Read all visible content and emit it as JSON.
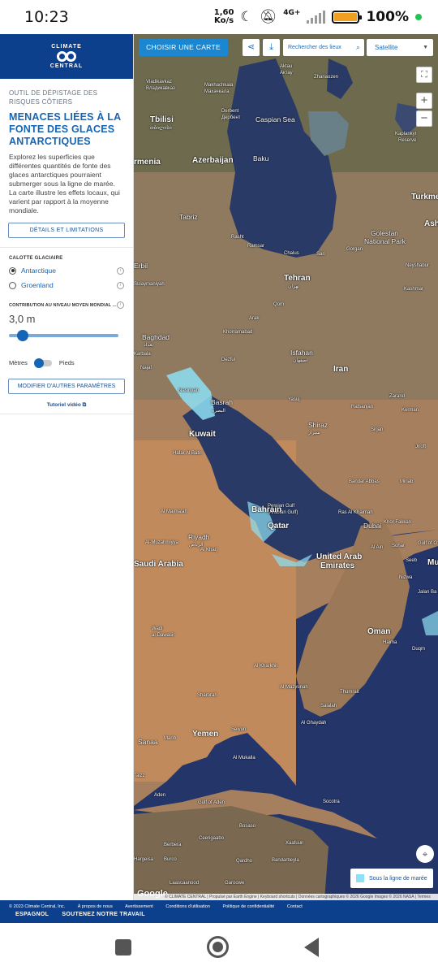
{
  "status_bar": {
    "time": "10:23",
    "net_speed_value": "1,60",
    "net_speed_unit": "Ko/s",
    "network_type": "4G+",
    "battery": "100%"
  },
  "sidebar": {
    "logo_line1": "CLIMATE",
    "logo_line2": "CENTRAL",
    "eyebrow": "OUTIL DE DÉPISTAGE DES RISQUES CÔTIERS",
    "title": "MENACES LIÉES À LA FONTE DES GLACES ANTARCTIQUES",
    "description": "Explorez les superficies que différentes quantités de fonte des glaces antarctiques pourraient submerger sous la ligne de marée. La carte illustre les effets locaux, qui varient par rapport à la moyenne mondiale.",
    "details_button": "DÉTAILS ET LIMITATIONS",
    "ice_cap_label": "CALOTTE GLACIAIRE",
    "ice_caps": [
      {
        "label": "Antarctique",
        "selected": true
      },
      {
        "label": "Groenland",
        "selected": false
      }
    ],
    "contribution_label": "CONTRIBUTION AU NIVEAU MOYEN MONDIAL ...",
    "contribution_value": "3,0 m",
    "unit_left": "Mètres",
    "unit_right": "Pieds",
    "modify_button": "MODIFIER D'AUTRES PARAMÈTRES",
    "tutorial_link": "Tutoriel vidéo"
  },
  "map": {
    "choose_map_button": "CHOISIR UNE CARTE",
    "search_placeholder": "Rechercher des lieux",
    "layer_select": "Satellite",
    "legend_label": "Sous la ligne de marée",
    "google": "Google",
    "attribution": "© CLIMATE CENTRAL | Propulsé par Earth Engine | Keyboard shortcuts | Données cartographiques © 2026 Google Images © 2026 NASA | Termes",
    "labels": {
      "caspian_sea": "Caspian Sea",
      "azerbaijan": "Azerbaijan",
      "armenia": "rmenia",
      "turkmen": "Turkme",
      "tbilisi": "Tbilisi",
      "tbilisi_local": "თბილისი",
      "baku": "Baku",
      "vladikavkaz": "Vladikavkaz",
      "vladikavkaz_local": "Владикавказ",
      "makhachkala": "Makhachkala",
      "makhachkala_local": "Махачкала",
      "derbent": "Derbent",
      "derbent_local": "Дербент",
      "aktau": "Aktau",
      "aktau_local": "Актау",
      "zhanaozen": "Zhanaozen",
      "kaplankyr": "Kaplankyr",
      "kaplankyr2": "Reserve",
      "tabriz": "Tabriz",
      "rasht": "Rasht",
      "ramsar": "Ramsar",
      "chalus": "Chalus",
      "sari": "Sari",
      "gorgan": "Gorgan",
      "golestan": "Golestan",
      "golestan2": "National Park",
      "erbil": "Erbil",
      "sulaymaniyah": "Sulaymaniyah",
      "tehran": "Tehran",
      "tehran_local": "تهران",
      "mashhad_area": "Ashg",
      "neyshabur": "Neyshabur",
      "kashmar": "Kashmar",
      "baghdad": "Baghdad",
      "baghdad_local": "بغداد",
      "karbala": "Karbala",
      "najaf": "Najaf",
      "isfahan": "Isfahan",
      "isfahan_local": "اصفهان",
      "iran": "Iran",
      "arak": "Arak",
      "qom": "Qom",
      "khorramabad": "Khorramabad",
      "dezful": "Dezful",
      "nasiriyah": "Nasiriyah",
      "basrah": "Basrah",
      "basrah_local": "البصرة",
      "kuwait": "Kuwait",
      "yasuj": "Yasuj",
      "shiraz": "Shiraz",
      "shiraz_local": "شیراز",
      "kerman": "Kerman",
      "zarand": "Zarand",
      "rafsanjan": "Rafsanjan",
      "sirjan": "Sirjan",
      "jiroft": "Jiroft",
      "hafar": "Hafar Al Batin",
      "persian_gulf": "Persian Gulf",
      "persian_gulf2": "(Arabian Gulf)",
      "bahrain": "Bahrain",
      "qatar": "Qatar",
      "bandar_abbas": "Bandar Abbas",
      "minab": "Minab",
      "ras_al_khaimah": "Ras Al Khaimah",
      "dubai": "Dubai",
      "khor_fakkan": "Khor Fakkan",
      "al_ain": "Al Ain",
      "sohar": "Sohar",
      "gulf_oman": "Gulf of O",
      "uae1": "United Arab",
      "uae2": "Emirates",
      "riyadh": "Riyadh",
      "riyadh_local": "الرياض",
      "al_majmaah": "Al Majma'ah",
      "al_muzahmiyya": "Al-Muzahmiyya",
      "al_kharj": "Al Kharj",
      "saudi": "Saudi Arabia",
      "seeb": "Seeb",
      "muscat": "Mus",
      "nizwa": "Nizwa",
      "jalan": "Jalan Ba",
      "oman": "Oman",
      "wadi_dawasir": "Wadi",
      "wadi_dawasir2": "al-Dawasir",
      "haima": "Haima",
      "duqm": "Duqm",
      "al_kharkhir": "Al Kharkhir",
      "sharorah": "Sharorah",
      "al_mazyunah": "Al Mazyunah",
      "thumrait": "Thumrait",
      "salalah": "Salalah",
      "yemen": "Yemen",
      "sanaa": "Sanaa",
      "marib": "Marib",
      "seiyun": "Seiyun",
      "al_ghaydah": "Al Ghaydah",
      "al_mukalla": "Al Mukalla",
      "aden": "Aden",
      "taizz": "Taizz",
      "gulf_aden": "Gulf of Aden",
      "socotra": "Socotra",
      "bosaso": "Bosaso",
      "ceerigaabo": "Ceerigaabo",
      "berbera": "Berbera",
      "hargeisa": "Hargeisa",
      "burco": "Burco",
      "qardho": "Qardho",
      "bandarbeyla": "Bandarbeyla",
      "xaafuun": "Xaafuun",
      "laascaanood": "Laascaanood",
      "garoowe": "Garoowe"
    }
  },
  "footer": {
    "links": [
      "© 2023 Climate Central, Inc.",
      "À propos de nous",
      "Avertissement",
      "Conditions d'utilisation",
      "Politique de confidentialité",
      "Contact"
    ],
    "spanish": "ESPAGNOL",
    "support": "SOUTENEZ NOTRE TRAVAIL"
  },
  "colors": {
    "brand_navy": "#0c3f8c",
    "accent_blue": "#1c86d0",
    "flood_cyan": "#8ee0f4",
    "sea_dark": "#2a3a66"
  }
}
